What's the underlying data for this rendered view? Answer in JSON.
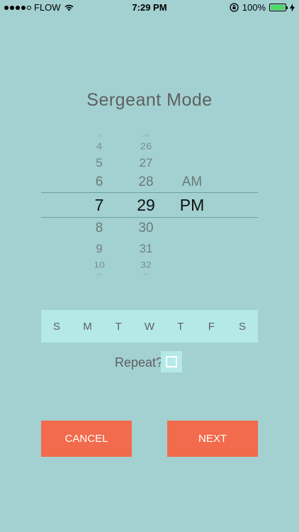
{
  "status_bar": {
    "carrier": "FLOW",
    "time": "7:29 PM",
    "battery": "100%"
  },
  "title": "Sergeant Mode",
  "picker": {
    "hours": [
      "3",
      "4",
      "5",
      "6",
      "7",
      "8",
      "9",
      "10",
      "11"
    ],
    "minutes": [
      "25",
      "26",
      "27",
      "28",
      "29",
      "30",
      "31",
      "32",
      "33"
    ],
    "ampm": [
      "AM",
      "PM"
    ],
    "selected": {
      "hour": "7",
      "minute": "29",
      "period": "PM"
    }
  },
  "days": [
    "S",
    "M",
    "T",
    "W",
    "T",
    "F",
    "S"
  ],
  "repeat": {
    "label": "Repeat?",
    "checked": false
  },
  "buttons": {
    "cancel": "CANCEL",
    "next": "NEXT"
  },
  "colors": {
    "background": "#a3d0d1",
    "panel": "#b5e9e8",
    "accent": "#f26b4c",
    "battery": "#4cd964"
  }
}
